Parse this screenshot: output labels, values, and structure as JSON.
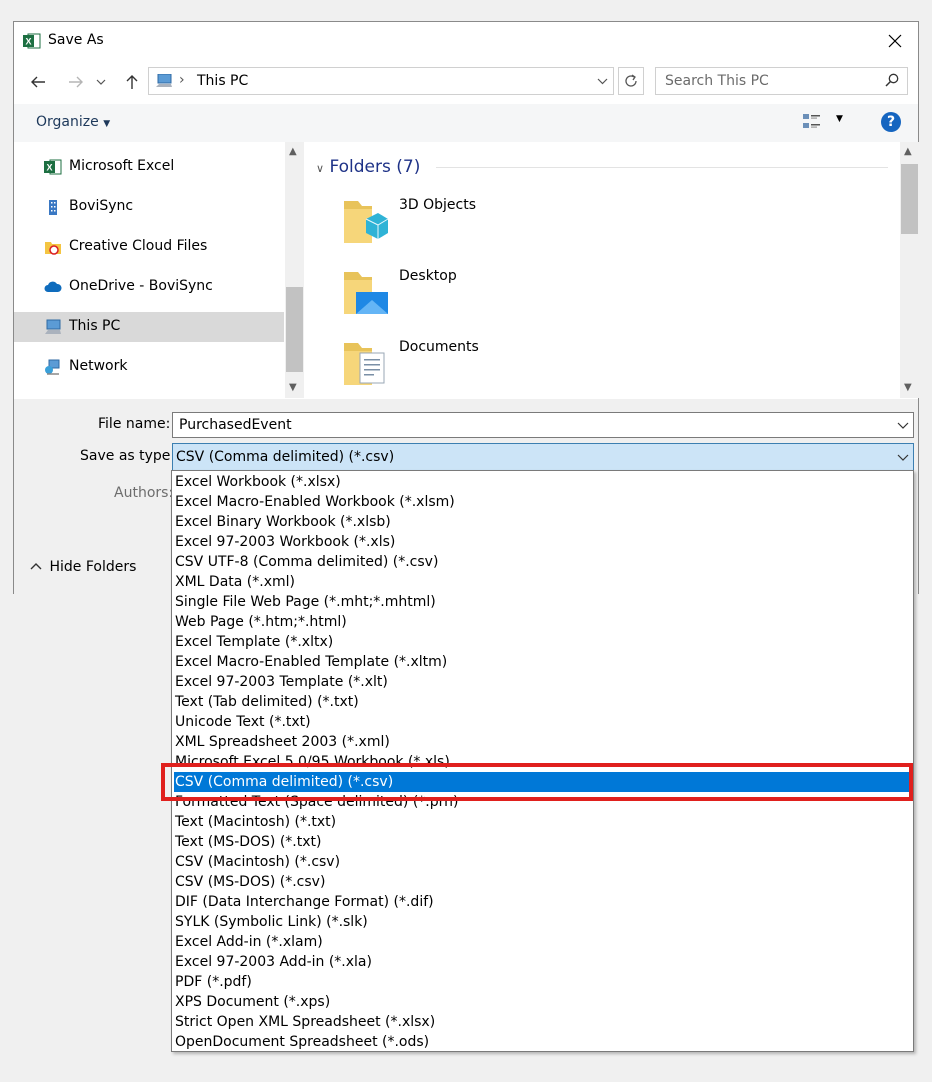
{
  "window": {
    "title": "Save As"
  },
  "address": {
    "path": "This PC",
    "search_placeholder": "Search This PC"
  },
  "toolbar": {
    "organize": "Organize",
    "help": "?"
  },
  "nav": {
    "items": [
      {
        "label": "Microsoft Excel",
        "icon": "excel-icon"
      },
      {
        "label": "BoviSync",
        "icon": "building-icon"
      },
      {
        "label": "Creative Cloud Files",
        "icon": "creative-cloud-folder-icon"
      },
      {
        "label": "OneDrive - BoviSync",
        "icon": "onedrive-cloud-icon"
      },
      {
        "label": "This PC",
        "icon": "computer-icon",
        "selected": true
      },
      {
        "label": "Network",
        "icon": "network-icon"
      }
    ]
  },
  "content": {
    "group_header": "Folders (7)",
    "folders": [
      {
        "label": "3D Objects",
        "icon": "3d-objects-folder-icon"
      },
      {
        "label": "Desktop",
        "icon": "desktop-folder-icon"
      },
      {
        "label": "Documents",
        "icon": "documents-folder-icon"
      }
    ]
  },
  "form": {
    "file_name_label": "File name:",
    "file_name_value": "PurchasedEvent",
    "save_as_type_label": "Save as type:",
    "save_as_type_value": "CSV (Comma delimited) (*.csv)",
    "authors_label": "Authors:",
    "hide_folders": "Hide Folders"
  },
  "dropdown": {
    "options": [
      "Excel Workbook (*.xlsx)",
      "Excel Macro-Enabled Workbook (*.xlsm)",
      "Excel Binary Workbook (*.xlsb)",
      "Excel 97-2003 Workbook (*.xls)",
      "CSV UTF-8 (Comma delimited) (*.csv)",
      "XML Data (*.xml)",
      "Single File Web Page (*.mht;*.mhtml)",
      "Web Page (*.htm;*.html)",
      "Excel Template (*.xltx)",
      "Excel Macro-Enabled Template (*.xltm)",
      "Excel 97-2003 Template (*.xlt)",
      "Text (Tab delimited) (*.txt)",
      "Unicode Text (*.txt)",
      "XML Spreadsheet 2003 (*.xml)",
      "Microsoft Excel 5.0/95 Workbook (*.xls)",
      "CSV (Comma delimited) (*.csv)",
      "Formatted Text (Space delimited) (*.prn)",
      "Text (Macintosh) (*.txt)",
      "Text (MS-DOS) (*.txt)",
      "CSV (Macintosh) (*.csv)",
      "CSV (MS-DOS) (*.csv)",
      "DIF (Data Interchange Format) (*.dif)",
      "SYLK (Symbolic Link) (*.slk)",
      "Excel Add-in (*.xlam)",
      "Excel 97-2003 Add-in (*.xla)",
      "PDF (*.pdf)",
      "XPS Document (*.xps)",
      "Strict Open XML Spreadsheet (*.xlsx)",
      "OpenDocument Spreadsheet (*.ods)"
    ],
    "selected_index": 15
  },
  "colors": {
    "accent": "#0078d7",
    "highlight": "#e0201d",
    "excel_green": "#1d6f42"
  }
}
